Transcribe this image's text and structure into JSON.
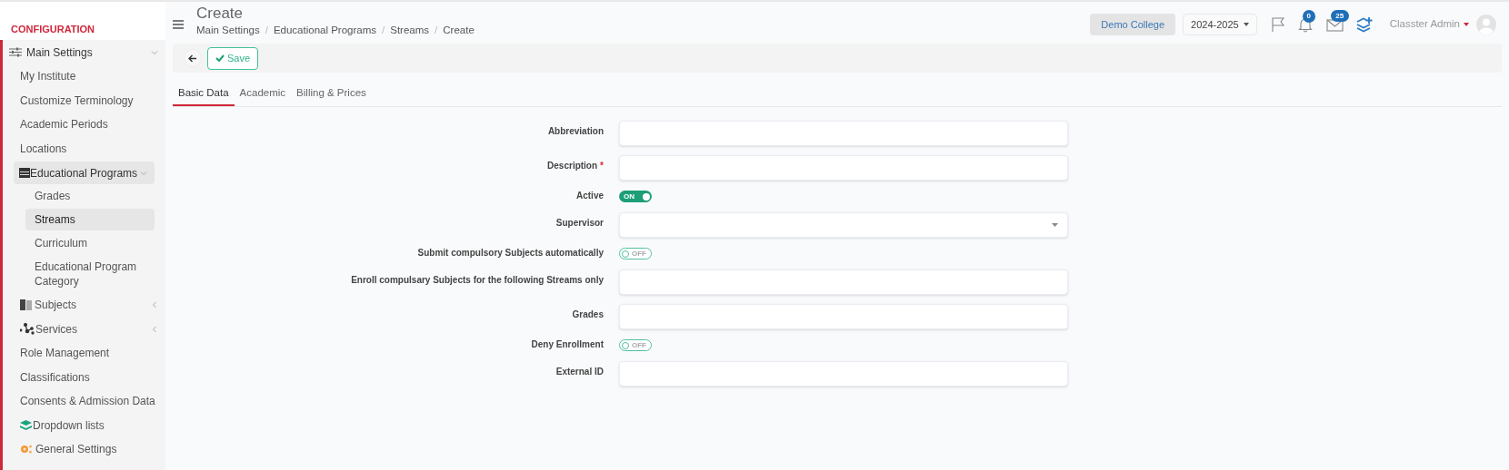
{
  "sidebar": {
    "heading": "CONFIGURATION",
    "items": [
      {
        "label": "Main Settings",
        "expanded": true,
        "children": [
          {
            "label": "My Institute"
          },
          {
            "label": "Customize Terminology"
          },
          {
            "label": "Academic Periods"
          },
          {
            "label": "Locations"
          },
          {
            "label": "Educational Programs",
            "expanded": true,
            "children": [
              {
                "label": "Grades",
                "selected": false
              },
              {
                "label": "Streams",
                "selected": true
              },
              {
                "label": "Curriculum",
                "selected": false
              },
              {
                "label": "Educational Program Category",
                "selected": false
              }
            ]
          },
          {
            "label": "Subjects",
            "expanded": false
          },
          {
            "label": "Services",
            "expanded": false
          },
          {
            "label": "Role Management"
          },
          {
            "label": "Classifications"
          },
          {
            "label": "Consents & Admission Data"
          },
          {
            "label": "Dropdown lists"
          },
          {
            "label": "General Settings"
          }
        ]
      }
    ]
  },
  "header": {
    "title": "Create",
    "breadcrumbs": [
      "Main Settings",
      "Educational Programs",
      "Streams",
      "Create"
    ],
    "separator": "/",
    "institution": "Demo College",
    "year": "2024-2025",
    "notifications": "0",
    "messages": "25",
    "user": "Classter Admin"
  },
  "toolbar": {
    "save": "Save"
  },
  "tabs": [
    {
      "label": "Basic Data",
      "selected": true
    },
    {
      "label": "Academic",
      "selected": false
    },
    {
      "label": "Billing & Prices",
      "selected": false
    }
  ],
  "form": [
    {
      "kind": "text",
      "label": "Abbreviation",
      "required": false
    },
    {
      "kind": "text",
      "label": "Description",
      "required": true,
      "required_mark": "*"
    },
    {
      "kind": "toggle",
      "label": "Active",
      "on": true,
      "text": "ON"
    },
    {
      "kind": "select",
      "label": "Supervisor",
      "required": false
    },
    {
      "kind": "toggle",
      "label": "Submit compulsory Subjects automatically",
      "on": false,
      "text": "OFF"
    },
    {
      "kind": "text",
      "label": "Enroll compulsary Subjects for the following Streams only",
      "required": false
    },
    {
      "kind": "text",
      "label": "Grades",
      "required": false
    },
    {
      "kind": "toggle",
      "label": "Deny Enrollment",
      "on": false,
      "text": "OFF"
    },
    {
      "kind": "text",
      "label": "External ID",
      "required": false
    }
  ]
}
